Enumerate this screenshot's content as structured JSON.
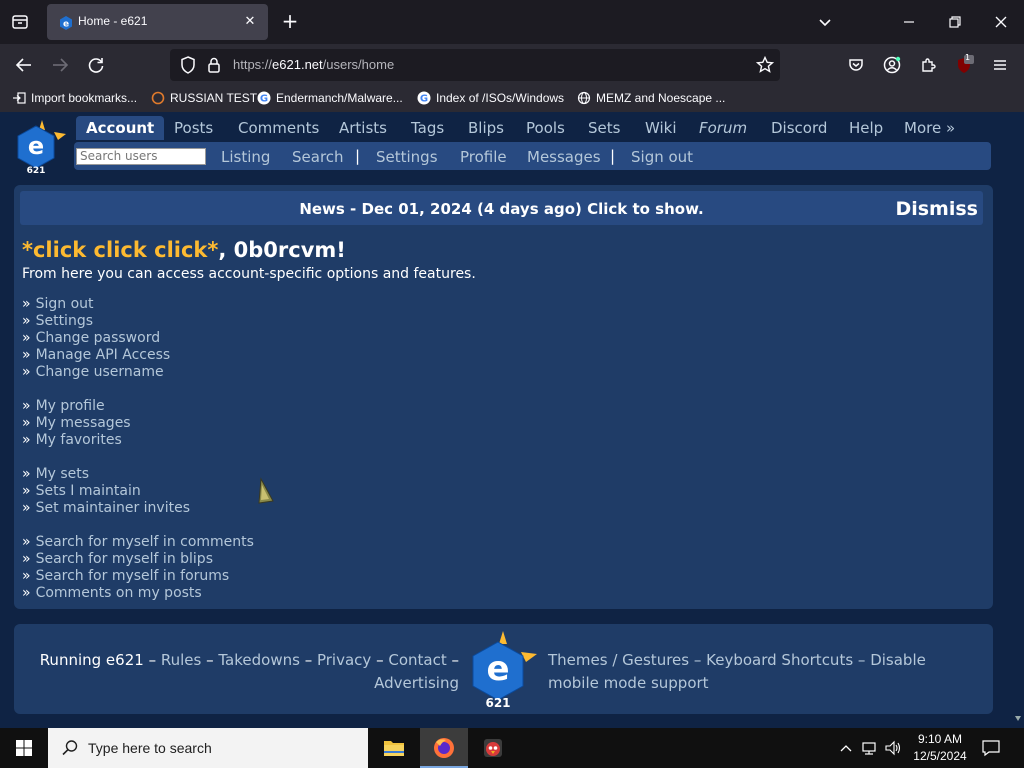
{
  "browser": {
    "tab_title": "Home - e621",
    "url_prefix": "https://",
    "url_domain": "e621.net",
    "url_path": "/users/home",
    "extension_badge": "1",
    "bookmarks": [
      "Import bookmarks...",
      "RUSSIAN TEST",
      "Endermanch/Malware...",
      "Index of /ISOs/Windows",
      "MEMZ and Noescape ..."
    ]
  },
  "site": {
    "main_nav": [
      "Account",
      "Posts",
      "Comments",
      "Artists",
      "Tags",
      "Blips",
      "Pools",
      "Sets",
      "Wiki",
      "Forum",
      "Discord",
      "Help",
      "More »"
    ],
    "search_placeholder": "Search users",
    "sub_nav": [
      "Listing",
      "Search",
      "Settings",
      "Profile",
      "Messages",
      "Sign out"
    ],
    "news": "News - Dec 01, 2024 (4 days ago) Click to show.",
    "dismiss": "Dismiss",
    "greeting_highlight": "*click click click*",
    "greeting_rest": ", 0b0rcvm!",
    "intro": "From here you can access account-specific options and features.",
    "bullet": "»",
    "links": [
      [
        "Sign out",
        "Settings",
        "Change password",
        "Manage API Access",
        "Change username"
      ],
      [
        "My profile",
        "My messages",
        "My favorites"
      ],
      [
        "My sets",
        "Sets I maintain",
        "Set maintainer invites"
      ],
      [
        "Search for myself in comments",
        "Search for myself in blips",
        "Search for myself in forums",
        "Comments on my posts"
      ]
    ],
    "footer": {
      "running": "Running e621",
      "dash": "–",
      "left_links": [
        "Rules",
        "Takedowns",
        "Privacy",
        "Contact",
        "Advertising"
      ],
      "right_links": [
        "Themes / Gestures",
        "Keyboard Shortcuts",
        "Disable mobile mode support"
      ]
    }
  },
  "taskbar": {
    "search_placeholder": "Type here to search",
    "time": "9:10 AM",
    "date": "12/5/2024"
  },
  "colors": {
    "page_bg": "#0f2344",
    "panel_bg": "#1f3c67",
    "nav_bg": "#284a81",
    "link": "#b4c7d9",
    "highlight": "#fdba31"
  }
}
